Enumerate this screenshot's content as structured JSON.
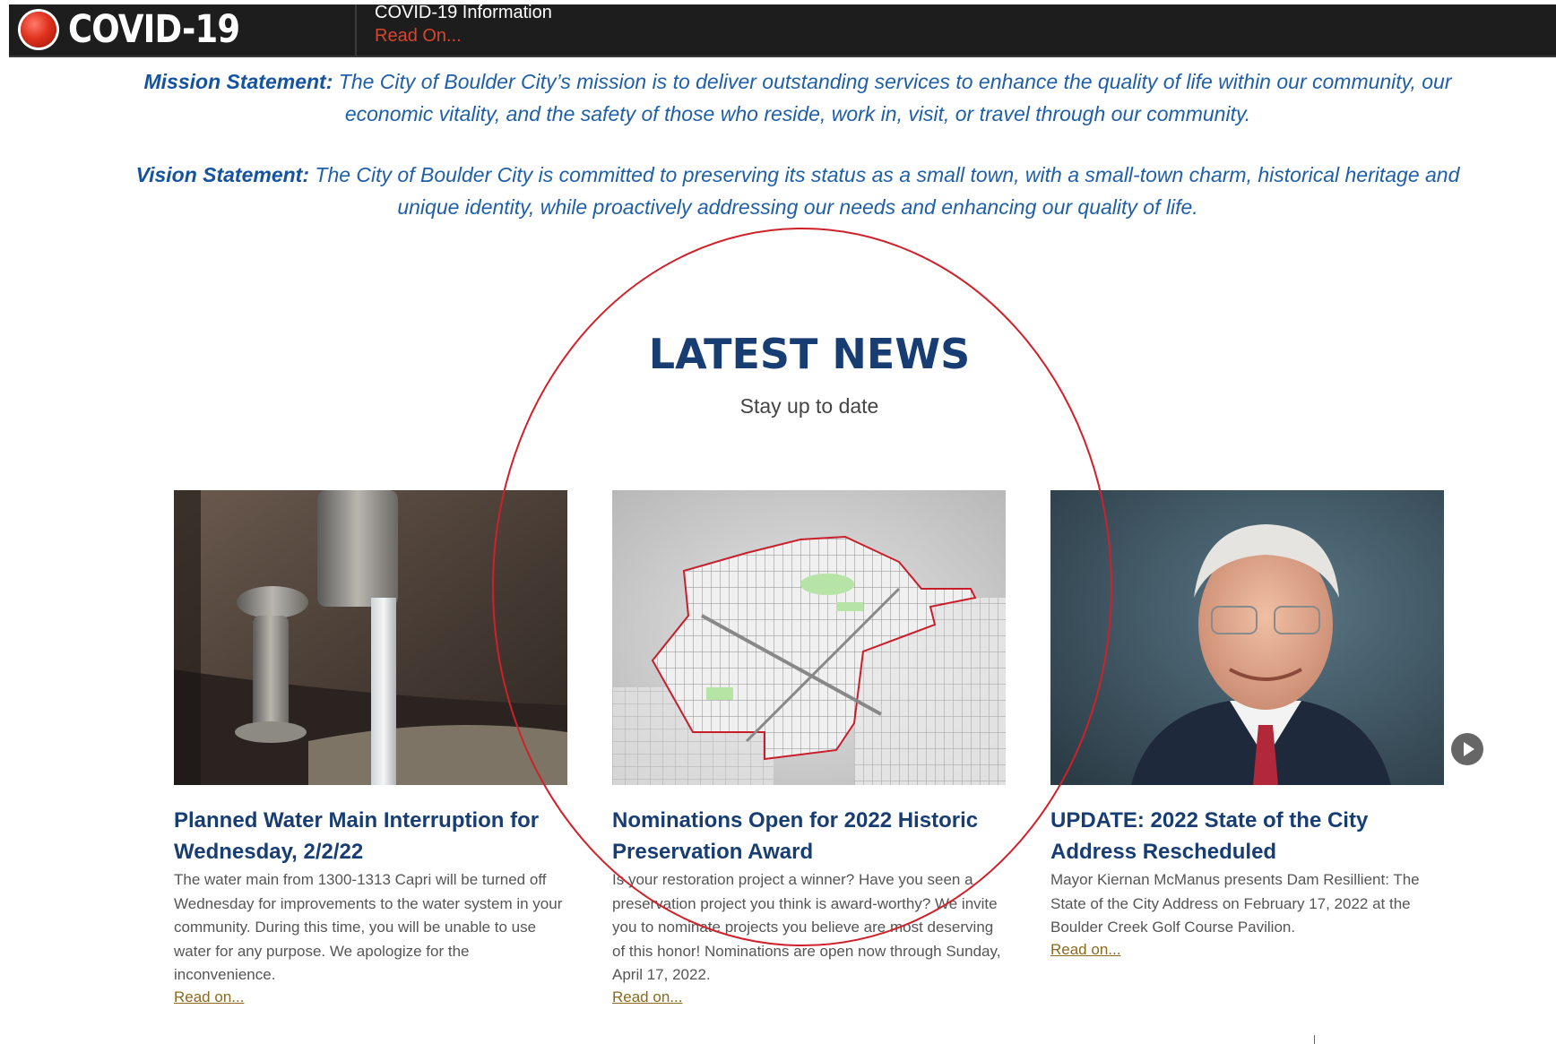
{
  "covid_bar": {
    "badge_label": "COVID-19",
    "info_label": "COVID-19 Information",
    "read_on_label": "Read On..."
  },
  "statements": {
    "mission_label": "Mission Statement:",
    "mission_text": "The City of Boulder City’s mission is to deliver outstanding services to enhance the quality of life within our community, our economic vitality, and the safety of those who reside, work in, visit, or travel through our community.",
    "vision_label": "Vision Statement:",
    "vision_text": "The City of Boulder City is committed to preserving its status as a small town, with a small-town charm, historical heritage and unique identity, while proactively addressing our needs and enhancing our quality of life."
  },
  "news": {
    "heading": "LATEST NEWS",
    "subheading": "Stay up to date",
    "articles": [
      {
        "title": "Planned Water Main Interruption for Wednesday, 2/2/22",
        "excerpt": "The water main from 1300-1313 Capri will be turned off Wednesday for improvements to the water system in your community. During this time, you will be unable to use water for any purpose. We apologize for the inconvenience.",
        "link": "Read on...",
        "image": "faucet-photo"
      },
      {
        "title": "Nominations Open for 2022 Historic Preservation Award",
        "excerpt": "Is your restoration project a winner? Have you seen a preservation project you think is award-worthy? We invite you to nominate projects you believe are most deserving of this honor! Nominations are open now through Sunday, April 17, 2022.",
        "link": "Read on...",
        "image": "historic-district-map"
      },
      {
        "title": "UPDATE: 2022 State of the City Address Rescheduled",
        "excerpt": "Mayor Kiernan McManus presents Dam Resillient: The State of the City Address on February 17, 2022 at the Boulder Creek Golf Course Pavilion.",
        "link": "Read on...",
        "image": "mayor-portrait"
      }
    ],
    "next_icon": "chevron-right-icon"
  },
  "annotation": {
    "ellipse_color": "#d0202a"
  }
}
